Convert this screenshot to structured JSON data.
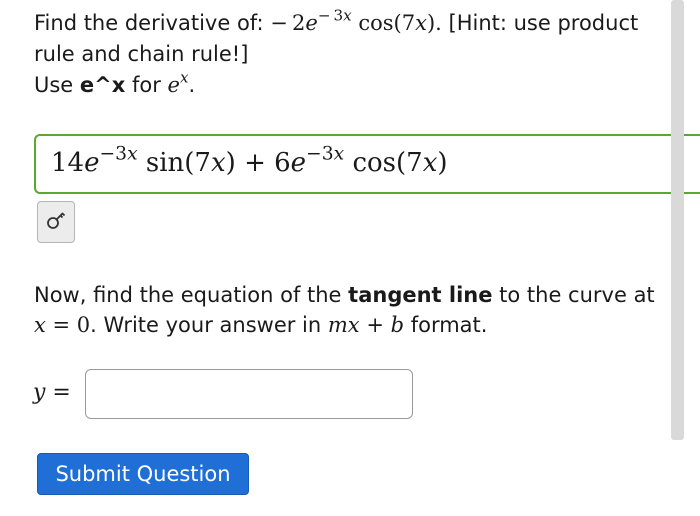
{
  "question": {
    "prefix": "Find the derivative of: ",
    "fn_neg": "−",
    "fn_coef": "2",
    "fn_e": "e",
    "fn_exp_minus": "−",
    "fn_exp_num": "3",
    "fn_exp_var": "x",
    "fn_cos": " cos(7",
    "fn_var": "x",
    "fn_close": ").",
    "hint_tail": " [Hint: use product",
    "line2": "rule and chain rule!]",
    "use_prefix": "Use ",
    "use_bold": "e^x",
    "use_mid": " for ",
    "use_e": "e",
    "use_sup": "x",
    "use_end": "."
  },
  "answer": {
    "c1": "14",
    "e1": "e",
    "exp1": "−3",
    "exp1_var": "x",
    "sin": " sin(7",
    "var1": "x",
    "mid": ") + 6",
    "e2": "e",
    "exp2": "−3",
    "exp2_var": "x",
    "cos": " cos(7",
    "var2": "x",
    "end": ")",
    "status_color": "#5aa832"
  },
  "preview_icon": "key-icon",
  "followup": {
    "t1": "Now, find the equation of the ",
    "bold": "tangent line",
    "t2": " to the curve at",
    "x_var": "x",
    "eq": " = 0",
    "t3": ". Write your answer in ",
    "m": "m",
    "x2": "x",
    "plus": " + ",
    "b": "b",
    "t4": " format."
  },
  "input": {
    "y_label": "y",
    "eq": " =",
    "value": ""
  },
  "submit": {
    "label": "Submit Question",
    "color": "#1f6fd6"
  }
}
